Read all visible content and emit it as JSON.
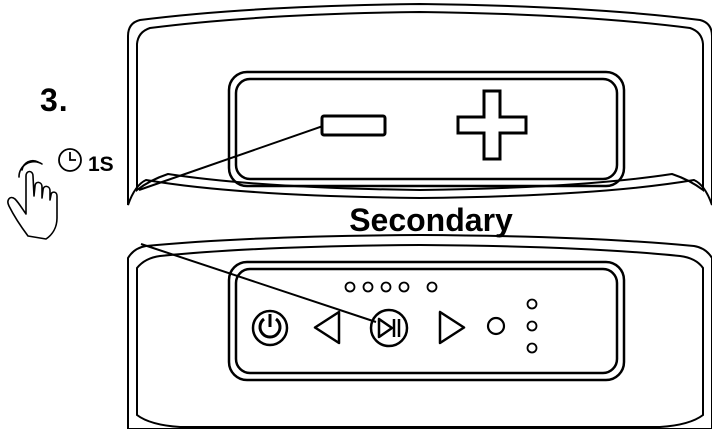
{
  "step_label": "3.",
  "hold_duration_label": "1S",
  "section_label": "Secondary",
  "icons": [
    "hand-press-icon",
    "clock-icon",
    "minus-icon",
    "plus-icon",
    "power-icon",
    "previous-icon",
    "play-pause-icon",
    "next-icon",
    "aux-indicator-icon",
    "battery-leds-icon",
    "status-leds-icon"
  ],
  "colors": {
    "stroke": "#000000",
    "background": "#ffffff"
  }
}
